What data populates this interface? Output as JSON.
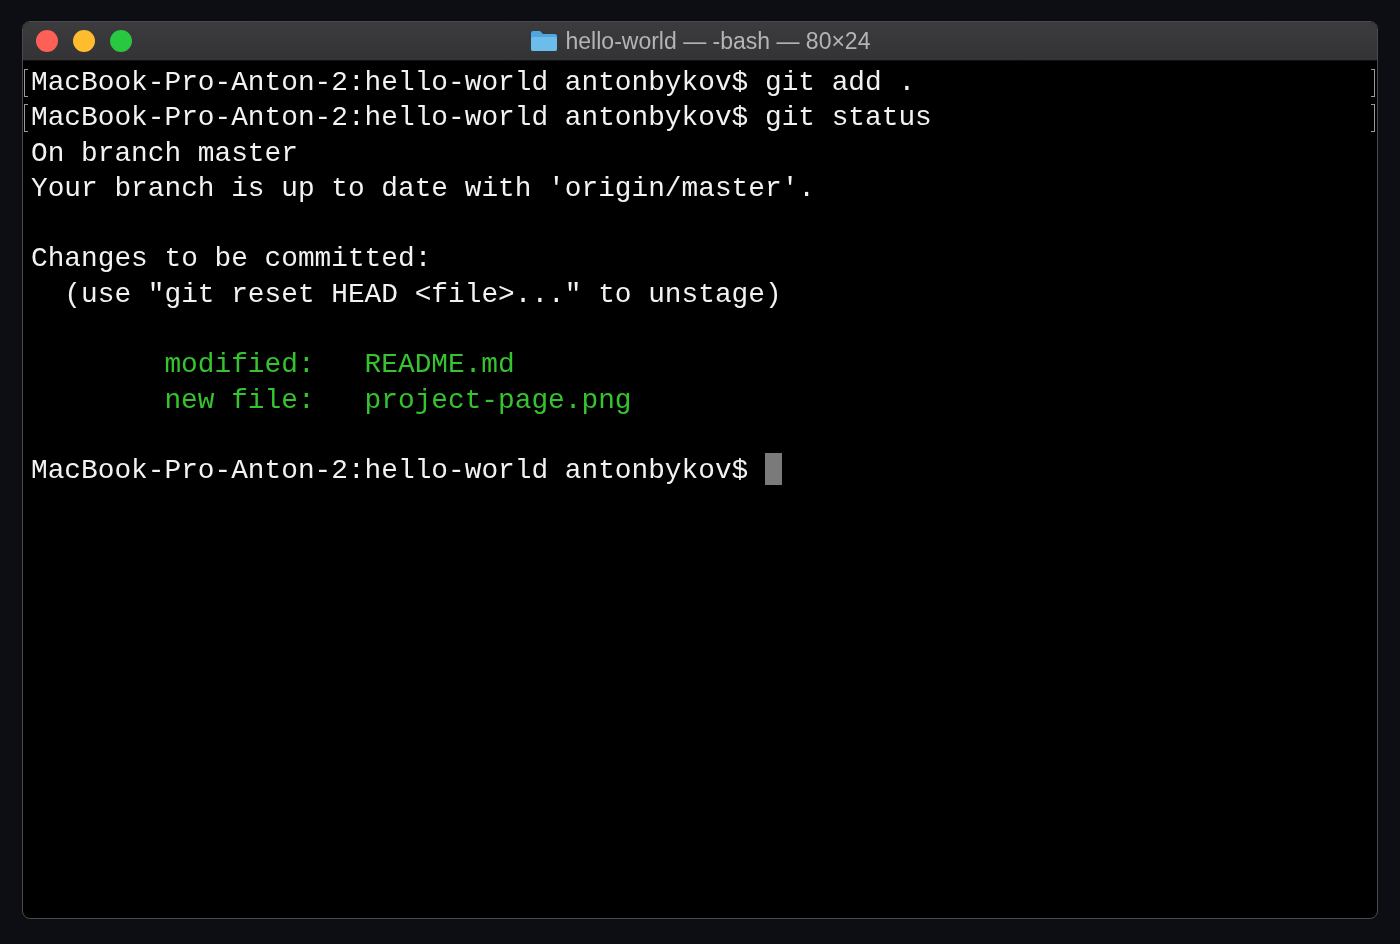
{
  "window": {
    "title": "hello-world — -bash — 80×24"
  },
  "lines": [
    {
      "kind": "text",
      "text": "MacBook-Pro-Anton-2:hello-world antonbykov$ git add .",
      "marked": true
    },
    {
      "kind": "text",
      "text": "MacBook-Pro-Anton-2:hello-world antonbykov$ git status",
      "marked": true
    },
    {
      "kind": "text",
      "text": "On branch master",
      "marked": false
    },
    {
      "kind": "text",
      "text": "Your branch is up to date with 'origin/master'.",
      "marked": false
    },
    {
      "kind": "blank"
    },
    {
      "kind": "text",
      "text": "Changes to be committed:",
      "marked": false
    },
    {
      "kind": "text",
      "text": "  (use \"git reset HEAD <file>...\" to unstage)",
      "marked": false
    },
    {
      "kind": "blank"
    },
    {
      "kind": "change",
      "status": "modified:",
      "file": "README.md"
    },
    {
      "kind": "change",
      "status": "new file:",
      "file": "project-page.png"
    },
    {
      "kind": "blank"
    },
    {
      "kind": "prompt",
      "text": "MacBook-Pro-Anton-2:hello-world antonbykov$",
      "cursor": true
    }
  ]
}
